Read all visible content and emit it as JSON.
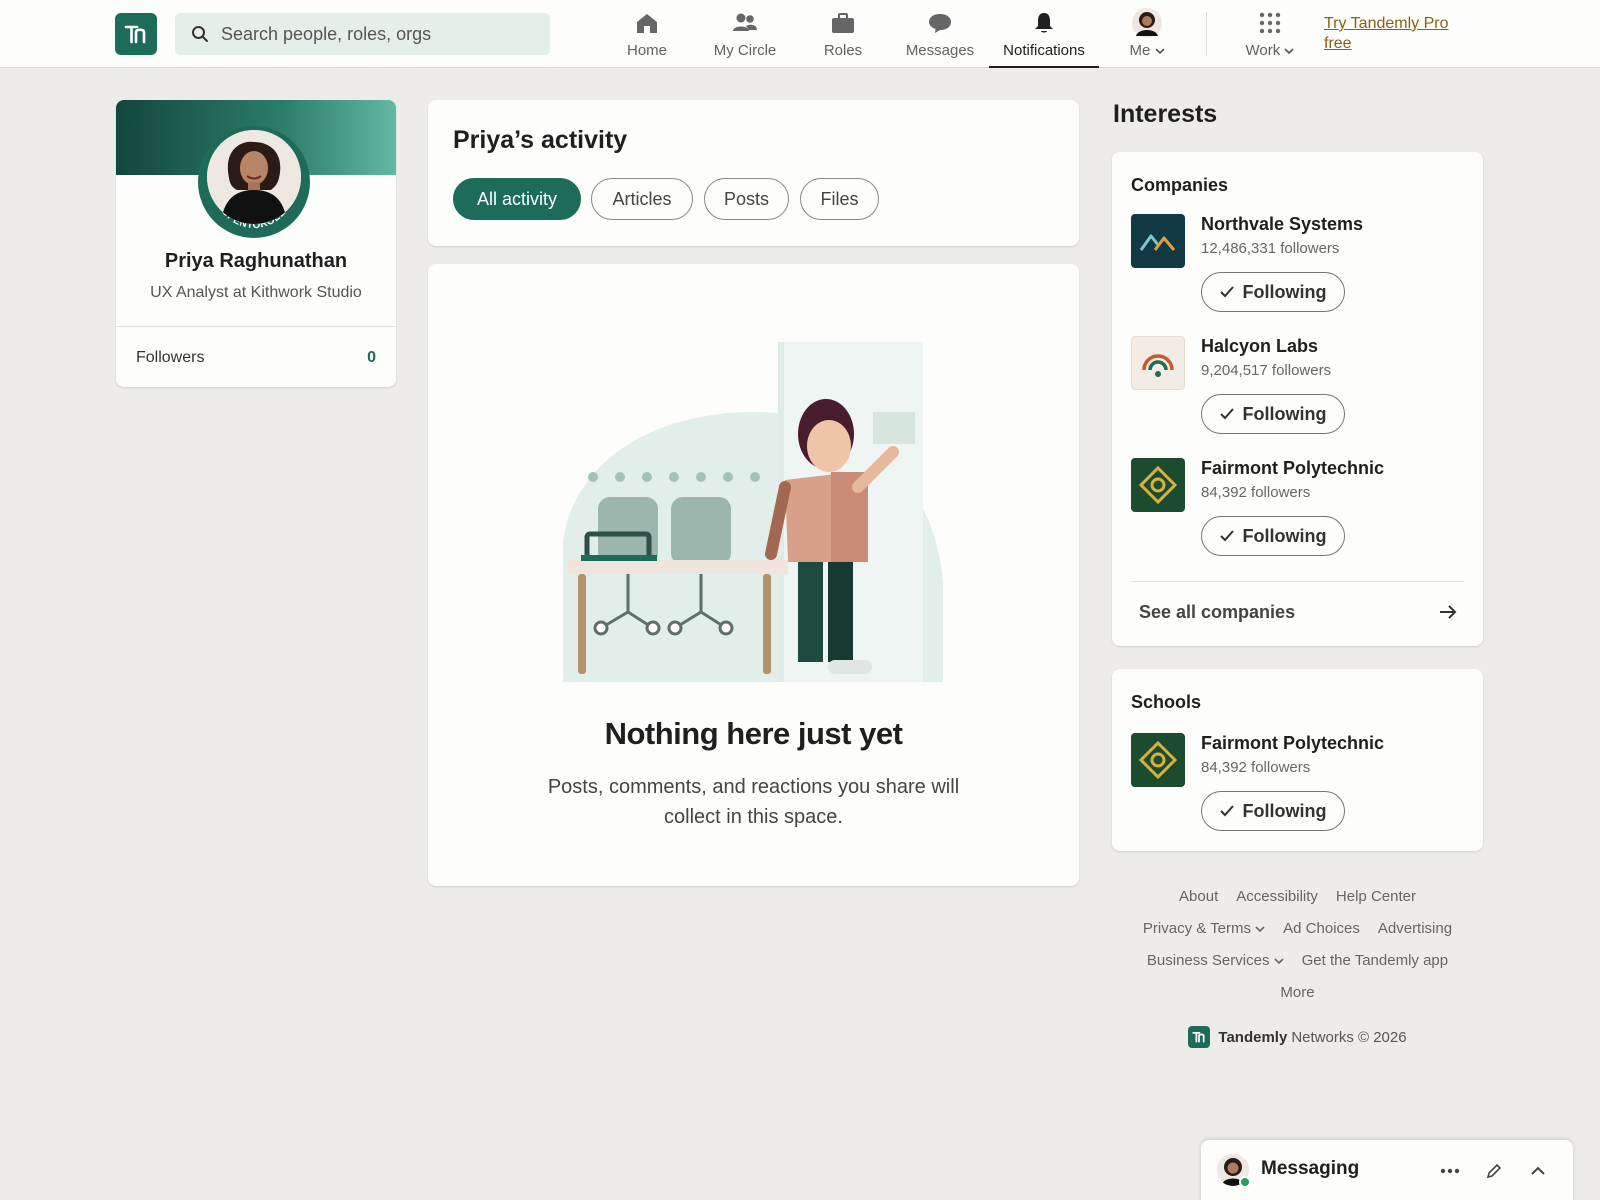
{
  "brand": {
    "logo_text": "Tandemly",
    "accent": "#1d6b59",
    "promo": "Try Tandemly Pro free"
  },
  "search": {
    "placeholder": "Search people, roles, orgs"
  },
  "nav": {
    "home": "Home",
    "my_circle": "My Circle",
    "roles": "Roles",
    "messages": "Messages",
    "notifications": "Notifications",
    "me": "Me",
    "work": "Work",
    "active": "Notifications"
  },
  "profile": {
    "name": "Priya Raghunathan",
    "headline": "UX Analyst at Kithwork Studio",
    "badge": "#OPENTOROLES",
    "followers_label": "Followers",
    "followers_count": "0"
  },
  "activity": {
    "title": "Priya’s activity",
    "filters": [
      "All activity",
      "Articles",
      "Posts",
      "Files"
    ],
    "selected_filter": "All activity",
    "empty_title": "Nothing here just yet",
    "empty_body": "Posts, comments, and reactions you share will collect in this space."
  },
  "interests": {
    "title": "Interests",
    "companies_title": "Companies",
    "companies": [
      {
        "name": "Northvale Systems",
        "followers": "12,486,331 followers",
        "button": "Following",
        "logo_icon": "mountain-logo-icon"
      },
      {
        "name": "Halcyon Labs",
        "followers": "9,204,517 followers",
        "button": "Following",
        "logo_icon": "rainbow-logo-icon"
      },
      {
        "name": "Fairmont Polytechnic",
        "followers": "84,392 followers",
        "button": "Following",
        "logo_icon": "diamond-logo-icon"
      }
    ],
    "see_all": "See all companies",
    "schools_title": "Schools",
    "schools": [
      {
        "name": "Fairmont Polytechnic",
        "followers": "84,392 followers",
        "button": "Following",
        "logo_icon": "diamond-logo-icon"
      }
    ]
  },
  "footer": {
    "row1": [
      "About",
      "Accessibility",
      "Help Center"
    ],
    "row2": [
      "Privacy & Terms",
      "Ad Choices",
      "Advertising"
    ],
    "row3": [
      "Business Services",
      "Get the Tandemly app"
    ],
    "row4": [
      "More"
    ],
    "company": "Tandemly",
    "copyright": "Networks © 2026"
  },
  "messaging": {
    "label": "Messaging"
  }
}
